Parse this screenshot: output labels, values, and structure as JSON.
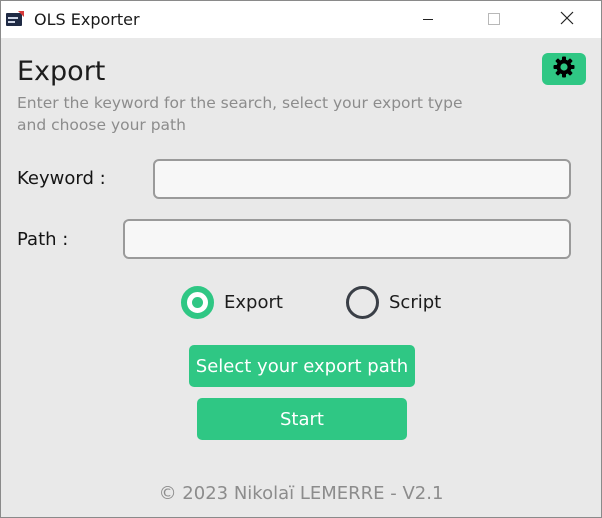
{
  "window": {
    "title": "OLS Exporter",
    "icons": {
      "app": "app-logo-icon",
      "minimize": "minimize-icon",
      "maximize": "maximize-icon",
      "close": "close-icon"
    }
  },
  "header": {
    "title": "Export",
    "subtitle": "Enter the keyword for the search, select your export type and choose your path",
    "settings_icon": "gear-icon"
  },
  "form": {
    "keyword_label": "Keyword :",
    "keyword_value": "",
    "path_label": "Path :",
    "path_value": ""
  },
  "export_type": {
    "options": [
      {
        "label": "Export",
        "selected": true
      },
      {
        "label": "Script",
        "selected": false
      }
    ]
  },
  "actions": {
    "select_path_label": "Select your export path",
    "start_label": "Start"
  },
  "footer": {
    "text": "© 2023 Nikolaï LEMERRE - V2.1"
  },
  "colors": {
    "accent": "#2fc784",
    "background": "#e9e9e9",
    "muted_text": "#8c8c8c"
  }
}
